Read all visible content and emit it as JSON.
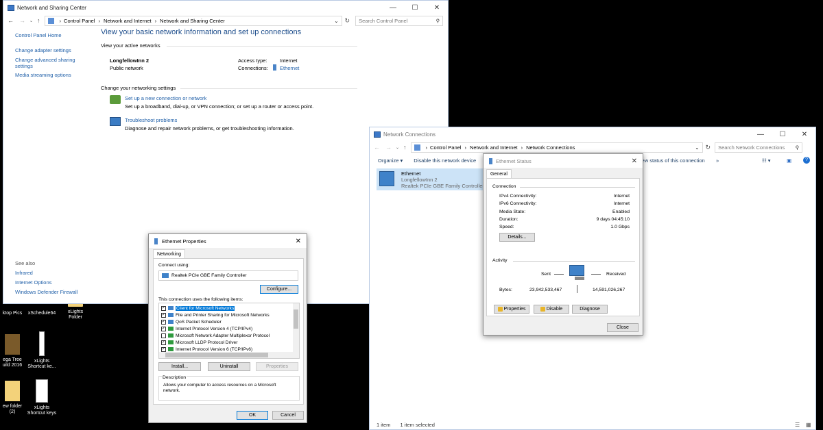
{
  "nsc": {
    "title": "Network and Sharing Center",
    "breadcrumb": [
      "Control Panel",
      "Network and Internet",
      "Network and Sharing Center"
    ],
    "search_placeholder": "Search Control Panel",
    "sidebar": {
      "home": "Control Panel Home",
      "items": [
        "Change adapter settings",
        "Change advanced sharing settings",
        "Media streaming options"
      ],
      "see_also": "See also",
      "see_also_items": [
        "Infrared",
        "Internet Options",
        "Windows Defender Firewall"
      ]
    },
    "heading": "View your basic network information and set up connections",
    "active_networks": "View your active networks",
    "network_name": "LongfellowInn  2",
    "network_type": "Public network",
    "access_type_label": "Access type:",
    "access_type_value": "Internet",
    "connections_label": "Connections:",
    "connections_value": "Ethernet",
    "change_settings": "Change your networking settings",
    "setup_title": "Set up a new connection or network",
    "setup_desc": "Set up a broadband, dial-up, or VPN connection; or set up a router or access point.",
    "trouble_title": "Troubleshoot problems",
    "trouble_desc": "Diagnose and repair network problems, or get troubleshooting information."
  },
  "nc": {
    "title": "Network Connections",
    "breadcrumb": [
      "Control Panel",
      "Network and Internet",
      "Network Connections"
    ],
    "search_placeholder": "Search Network Connections",
    "toolbar": {
      "organize": "Organize",
      "disable": "Disable this network device",
      "view_status": "View status of this connection",
      "more": "»"
    },
    "adapter": {
      "name": "Ethernet",
      "network": "LongfellowInn  2",
      "device": "Realtek PCIe GBE Family Controller"
    },
    "status_bar": {
      "items": "1 item",
      "selected": "1 item selected"
    }
  },
  "status": {
    "title": "Ethernet Status",
    "tab": "General",
    "connection": "Connection",
    "rows": [
      {
        "label": "IPv4 Connectivity:",
        "value": "Internet"
      },
      {
        "label": "IPv6 Connectivity:",
        "value": "Internet"
      },
      {
        "label": "Media State:",
        "value": "Enabled"
      },
      {
        "label": "Duration:",
        "value": "9 days 04:45:10"
      },
      {
        "label": "Speed:",
        "value": "1.0 Gbps"
      }
    ],
    "details": "Details...",
    "activity": "Activity",
    "sent": "Sent",
    "received": "Received",
    "bytes_label": "Bytes:",
    "bytes_sent": "23,942,533,467",
    "bytes_received": "14,591,026,267",
    "properties": "Properties",
    "disable": "Disable",
    "diagnose": "Diagnose",
    "close": "Close"
  },
  "props": {
    "title": "Ethernet Properties",
    "tab": "Networking",
    "connect_using": "Connect using:",
    "adapter": "Realtek PCIe GBE Family Controller",
    "configure": "Configure...",
    "items_label": "This connection uses the following items:",
    "items": [
      {
        "label": "Client for Microsoft Networks",
        "checked": true
      },
      {
        "label": "File and Printer Sharing for Microsoft Networks",
        "checked": true
      },
      {
        "label": "QoS Packet Scheduler",
        "checked": true
      },
      {
        "label": "Internet Protocol Version 4 (TCP/IPv4)",
        "checked": true
      },
      {
        "label": "Microsoft Network Adapter Multiplexor Protocol",
        "checked": false
      },
      {
        "label": "Microsoft LLDP Protocol Driver",
        "checked": true
      },
      {
        "label": "Internet Protocol Version 6 (TCP/IPv6)",
        "checked": true
      }
    ],
    "install": "Install...",
    "uninstall": "Uninstall",
    "properties": "Properties",
    "description_label": "Description",
    "description": "Allows your computer to access resources on a Microsoft network.",
    "ok": "OK",
    "cancel": "Cancel"
  },
  "desktop": {
    "icons": [
      "ktop Pics",
      "xSchedule64",
      "xLights Folder",
      "ega Tree uild 2016",
      "xLights Shortcut ke...",
      "ew folder (2)",
      "xLights Shortcut keys"
    ]
  }
}
